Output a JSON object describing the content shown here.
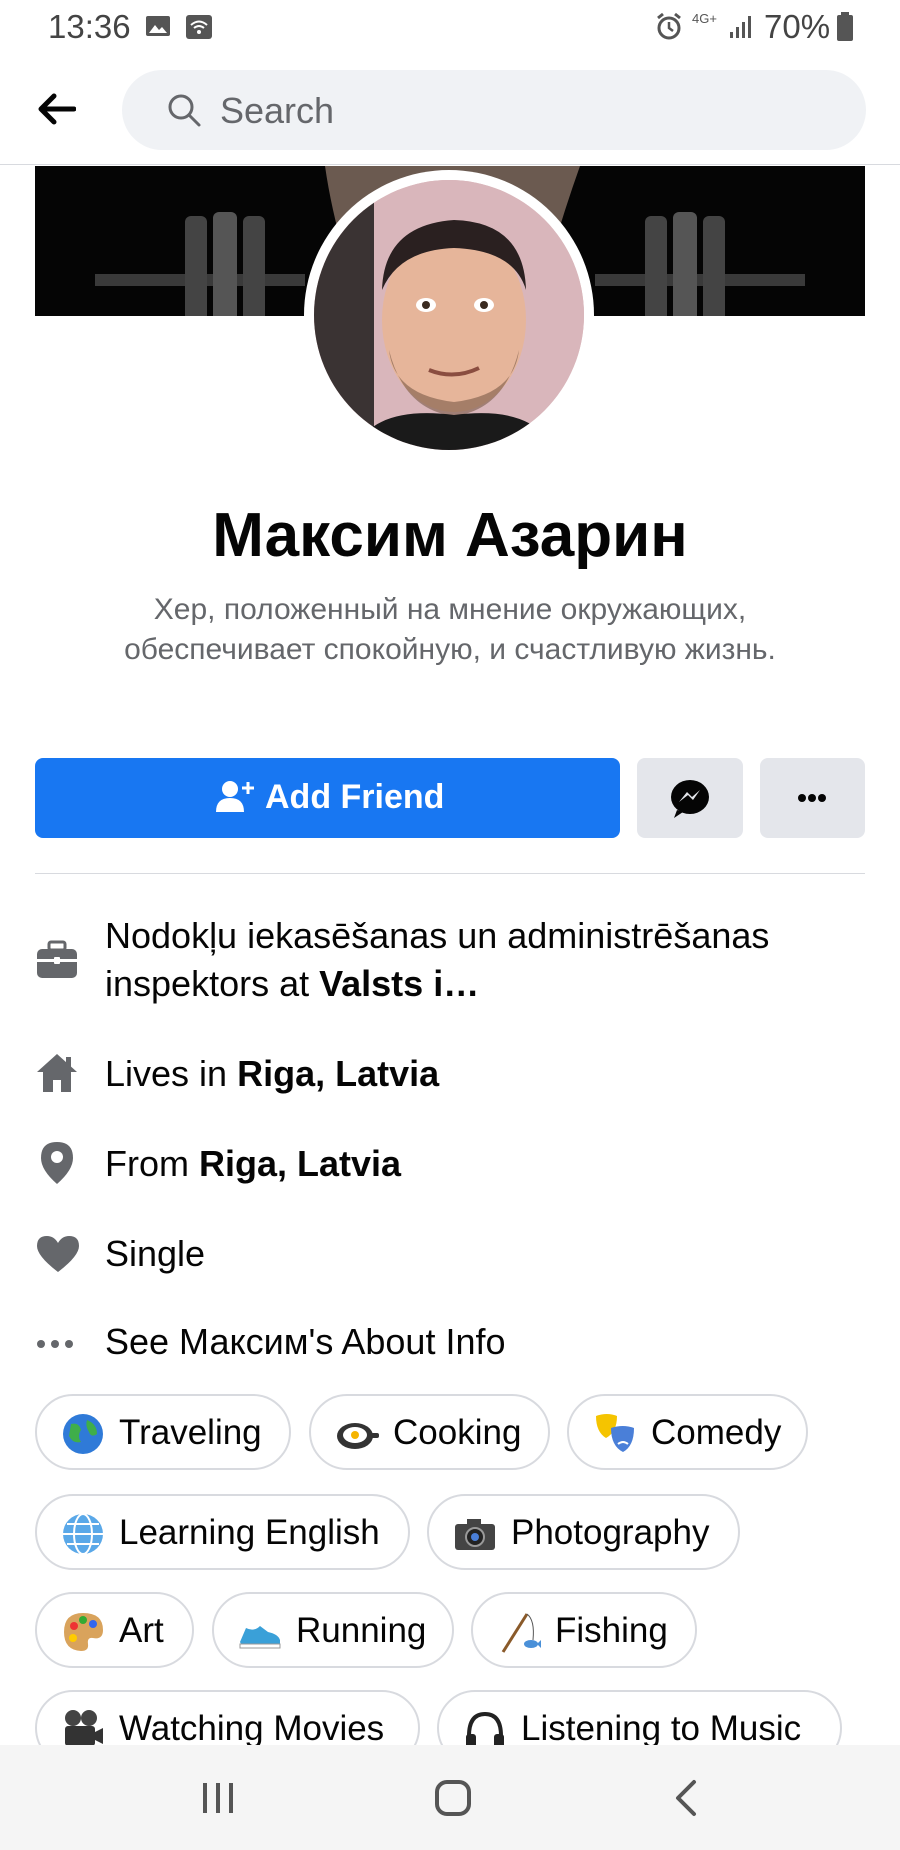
{
  "status_bar": {
    "time": "13:36",
    "battery": "70%",
    "network": "4G+"
  },
  "header": {
    "search_placeholder": "Search"
  },
  "profile": {
    "name": "Максим Азарин",
    "bio": "Хер, положенный на мнение окружающих, обеспечивает спокойную, и счастливую жизнь."
  },
  "actions": {
    "add_friend_label": "Add Friend"
  },
  "info": {
    "work_prefix": "Nodokļu iekasēšanas un administrēšanas inspektors at ",
    "work_place": "Valsts i…",
    "lives_prefix": "Lives in ",
    "lives_place": "Riga, Latvia",
    "from_prefix": "From ",
    "from_place": "Riga, Latvia",
    "relationship": "Single",
    "see_about": "See Максим's About Info"
  },
  "hobbies": [
    "Traveling",
    "Cooking",
    "Comedy",
    "Learning English",
    "Photography",
    "Art",
    "Running",
    "Fishing",
    "Watching Movies",
    "Listening to Music"
  ],
  "colors": {
    "accent": "#1877f2",
    "secondary_button": "#e4e6eb",
    "icon_gray": "#65676b"
  }
}
